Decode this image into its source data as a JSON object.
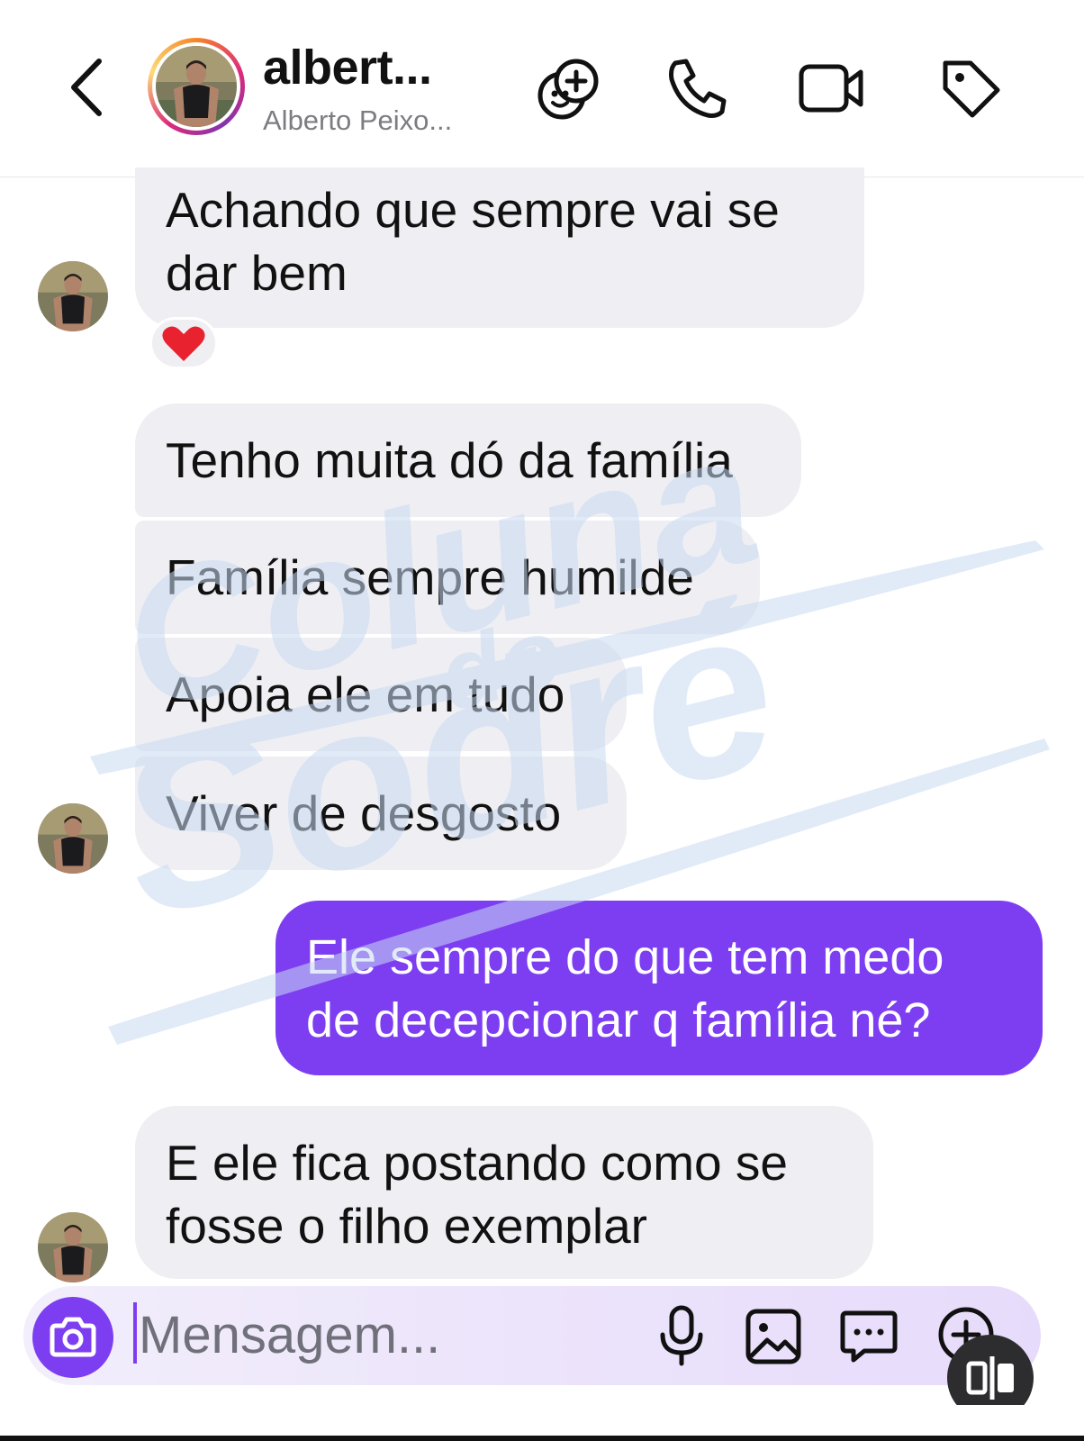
{
  "header": {
    "back_icon": "chevron-left-icon",
    "title": "albert...",
    "subtitle": "Alberto Peixo...",
    "icons": [
      "effects-icon",
      "phone-icon",
      "video-camera-icon",
      "tag-icon"
    ]
  },
  "messages": [
    {
      "id": "m1",
      "direction": "incoming",
      "lines": [
        "Achando que sempre vai se",
        "dar bem"
      ],
      "reaction": "❤️"
    },
    {
      "id": "m2",
      "direction": "incoming",
      "lines": [
        "Tenho muita dó da família"
      ]
    },
    {
      "id": "m3",
      "direction": "incoming",
      "lines": [
        "Família sempre humilde"
      ]
    },
    {
      "id": "m4",
      "direction": "incoming",
      "lines": [
        "Apoia ele em tudo"
      ]
    },
    {
      "id": "m5",
      "direction": "incoming",
      "lines": [
        "Viver de desgosto"
      ]
    },
    {
      "id": "m6",
      "direction": "outgoing",
      "lines": [
        "Ele sempre do que tem medo",
        "de decepcionar q família né?"
      ]
    },
    {
      "id": "m7",
      "direction": "incoming",
      "lines": [
        "E ele fica postando como se",
        "fosse o filho exemplar"
      ]
    }
  ],
  "watermark": {
    "line1": "Coluna",
    "line2": "do",
    "line3": "Sodré"
  },
  "composer": {
    "placeholder": "Mensagem...",
    "icons": [
      "camera-icon",
      "microphone-icon",
      "gallery-icon",
      "chat-sticker-icon",
      "add-icon"
    ]
  },
  "colors": {
    "accent": "#7d3ef2",
    "incoming_bubble": "#efeff3",
    "watermark": "#c9dbf2"
  }
}
